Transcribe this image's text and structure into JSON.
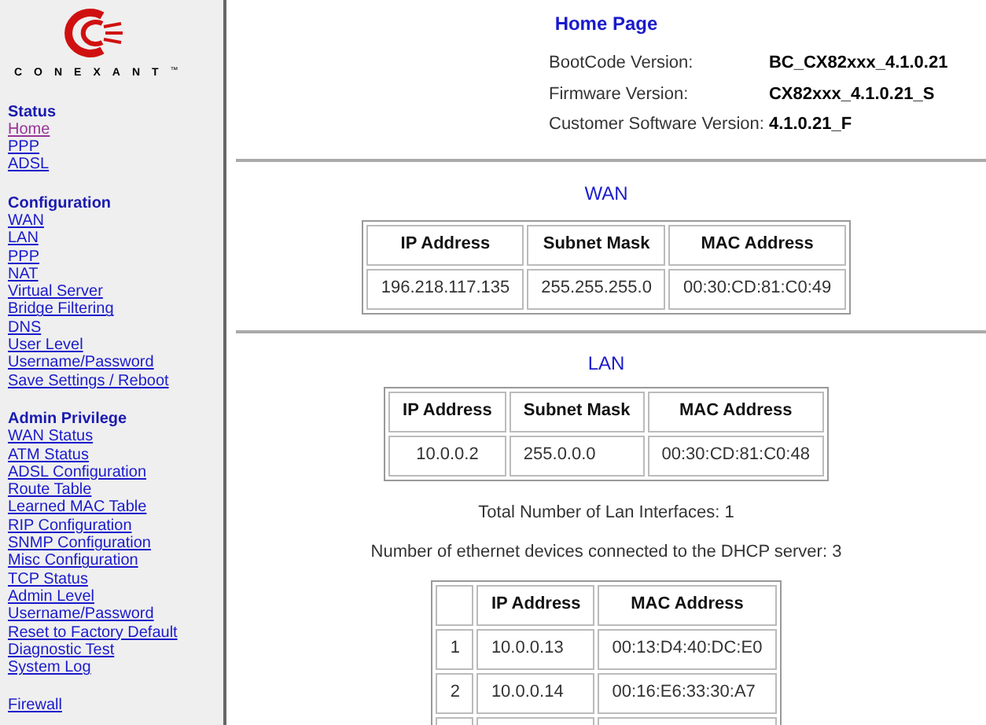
{
  "sidebar": {
    "logo_text": "CONEXANT",
    "logo_mark": "™",
    "sections": [
      {
        "heading": "Status",
        "links": [
          {
            "label": "Home",
            "visited": true
          },
          {
            "label": "PPP",
            "visited": false
          },
          {
            "label": "ADSL",
            "visited": false
          }
        ]
      },
      {
        "heading": "Configuration",
        "links": [
          {
            "label": "WAN",
            "visited": false
          },
          {
            "label": "LAN",
            "visited": false
          },
          {
            "label": "PPP",
            "visited": false
          },
          {
            "label": "NAT",
            "visited": false
          },
          {
            "label": "Virtual Server",
            "visited": false
          },
          {
            "label": "Bridge Filtering",
            "visited": false
          },
          {
            "label": "DNS",
            "visited": false
          },
          {
            "label": "User Level",
            "visited": false
          },
          {
            "label": "Username/Password",
            "visited": false
          },
          {
            "label": "Save Settings / Reboot",
            "visited": false
          }
        ]
      },
      {
        "heading": "Admin Privilege",
        "links": [
          {
            "label": "WAN Status",
            "visited": false
          },
          {
            "label": "ATM Status",
            "visited": false
          },
          {
            "label": "ADSL Configuration",
            "visited": false
          },
          {
            "label": "Route Table",
            "visited": false
          },
          {
            "label": "Learned MAC Table",
            "visited": false
          },
          {
            "label": "RIP Configuration",
            "visited": false
          },
          {
            "label": "SNMP Configuration",
            "visited": false
          },
          {
            "label": "Misc Configuration",
            "visited": false
          },
          {
            "label": "TCP Status",
            "visited": false
          },
          {
            "label": "Admin Level",
            "visited": false
          },
          {
            "label": "Username/Password",
            "visited": false
          },
          {
            "label": "Reset to Factory Default",
            "visited": false
          },
          {
            "label": "Diagnostic Test",
            "visited": false
          },
          {
            "label": "System Log",
            "visited": false
          }
        ]
      },
      {
        "links": [
          {
            "label": "Firewall",
            "visited": false
          }
        ]
      }
    ]
  },
  "page_title": "Home Page",
  "versions": [
    {
      "label": "BootCode Version:",
      "value": "BC_CX82xxx_4.1.0.21"
    },
    {
      "label": "Firmware Version:",
      "value": "CX82xxx_4.1.0.21_S"
    },
    {
      "label": "Customer Software Version:",
      "value": "4.1.0.21_F"
    }
  ],
  "wan": {
    "title": "WAN",
    "columns": [
      "IP Address",
      "Subnet Mask",
      "MAC Address"
    ],
    "rows": [
      [
        "196.218.117.135",
        "255.255.255.0",
        "00:30:CD:81:C0:49"
      ]
    ]
  },
  "lan": {
    "title": "LAN",
    "columns": [
      "IP Address",
      "Subnet Mask",
      "MAC Address"
    ],
    "rows": [
      [
        "10.0.0.2",
        "255.0.0.0",
        "00:30:CD:81:C0:48"
      ]
    ]
  },
  "lan_count": "Total Number of Lan Interfaces: 1",
  "dhcp_count": "Number of ethernet devices connected to the DHCP server: 3",
  "dhcp": {
    "columns": [
      "",
      "IP Address",
      "MAC Address"
    ],
    "rows": [
      [
        "1",
        "10.0.0.13",
        "00:13:D4:40:DC:E0"
      ],
      [
        "2",
        "10.0.0.14",
        "00:16:E6:33:30:A7"
      ]
    ]
  }
}
